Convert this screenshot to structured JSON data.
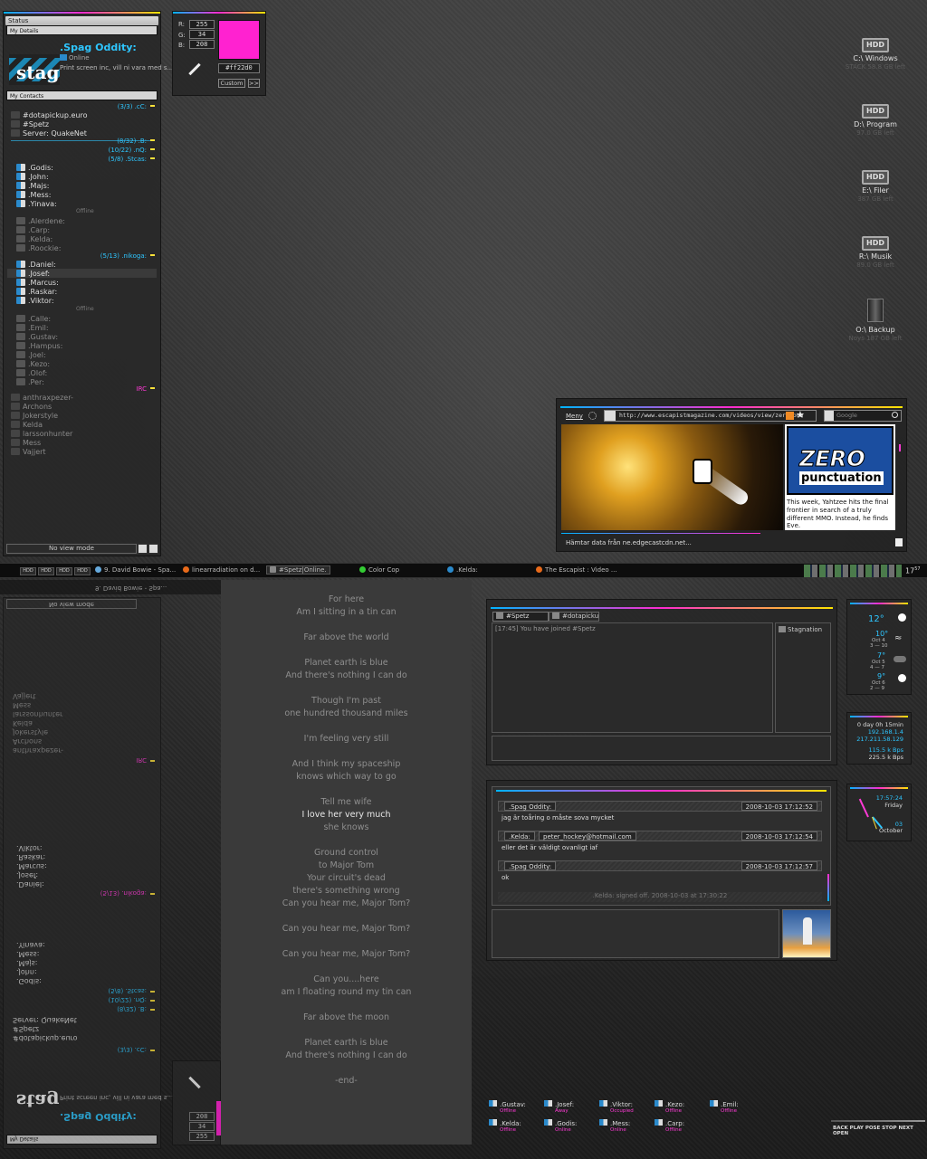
{
  "left_panel": {
    "status_label": "Status",
    "my_details_label": "My Details",
    "user_name": ".Spag Oddity:",
    "user_status": "Online",
    "user_message": "Print screen inc, vill ni vara med s...",
    "logo_text": "stag",
    "my_contacts_label": "My Contacts",
    "irc_group": "(3/3)  .cC:",
    "irc_items": [
      "#dotapickup.euro",
      "#Spetz",
      "Server: QuakeNet"
    ],
    "group_b": "(8/32)  .B:",
    "group_nq": "(10/22)  .nQ:",
    "group_stcas": "(5/8)  .Stcas:",
    "stcas_online": [
      ".Godis:",
      ".John:",
      ".Majs:",
      ".Mess:",
      ".Yinava:"
    ],
    "offline_label": "Offline",
    "stcas_offline": [
      ".Alerdene:",
      ".Carp:",
      ".Kelda:",
      ".Roockie:"
    ],
    "group_nikoga": "(5/13)  .nikoga:",
    "nikoga_online": [
      ".Daniel:",
      ".Josef:",
      ".Marcus:",
      ".Raskar:",
      ".Viktor:"
    ],
    "nikoga_offline": [
      ".Calle:",
      ".Emil:",
      ".Gustav:",
      ".Hampus:",
      ".Joel:",
      ".Kezo:",
      ".Olof:",
      ".Per:"
    ],
    "irc_label": "IRC",
    "irc_users": [
      "anthraxpezer-",
      "Archons",
      "Jokerstyle",
      "Kelda",
      "larssonhunter",
      "Mess",
      "Vajjert"
    ],
    "view_mode": "No view mode"
  },
  "color_picker": {
    "r_label": "R:",
    "g_label": "G:",
    "b_label": "B:",
    "r": "255",
    "g": "34",
    "b": "208",
    "hex": "#ff22d0",
    "swatch": "#ff22d0",
    "custom_label": "Custom",
    "more_label": ">>"
  },
  "drives": [
    {
      "label": "C:\\ Windows",
      "sub": "STACK 58.8 GB left"
    },
    {
      "label": "D:\\ Program",
      "sub": "97.0 GB left"
    },
    {
      "label": "E:\\ Filer",
      "sub": "387 GB left"
    },
    {
      "label": "R:\\ Musik",
      "sub": "89.0 GB left"
    },
    {
      "label": "O:\\ Backup",
      "sub": "Noys 187 GB left"
    }
  ],
  "drive_icon_text": "HDD",
  "browser": {
    "menu_label": "Meny",
    "url": "http://www.escapistmagazine.com/videos/view/zero-pun",
    "search_placeholder": "Google",
    "logo_line1": "ZERO",
    "logo_line2": "punctuation",
    "article_text": "This week, Yahtzee hits the final frontier in search of a truly different MMO. Instead, he finds Eve.",
    "status": "Hämtar data från ne.edgecastcdn.net..."
  },
  "taskbar": {
    "items": [
      "9. David Bowie - Spa...",
      "linearradiation on d...",
      "#Spetz|Online.",
      "Color Cop",
      ".Kelda:",
      "The Escapist : Video ..."
    ],
    "clock": "17",
    "clock_sup": "57"
  },
  "lyrics": [
    "For here",
    "Am I sitting in a tin can",
    "",
    "Far above the world",
    "",
    "Planet earth is blue",
    "And there's nothing I can do",
    "",
    "Though I'm past",
    "one hundred thousand miles",
    "",
    "I'm feeling very still",
    "",
    "And I think my spaceship",
    "knows which way to go",
    "",
    "Tell me wife",
    "I love her very much",
    "she knows",
    "",
    "Ground control",
    "to Major Tom",
    "Your circuit's dead",
    "there's something wrong",
    "Can you hear me, Major Tom?",
    "",
    "Can you hear me, Major Tom?",
    "",
    "Can you hear me, Major Tom?",
    "",
    "Can you....here",
    "am I floating round my tin can",
    "",
    "Far above the moon",
    "",
    "Planet earth is blue",
    "And there's nothing I can do",
    "",
    "-end-"
  ],
  "lyrics_highlight_index": 17,
  "media_controls": "BACK PLAY POSE STOP NEXT OPEN",
  "irc_window": {
    "tabs": [
      "#Spetz",
      "#dotapicku..."
    ],
    "join_line": "[17:45]  You have joined #Spetz",
    "nick": "Stagnation"
  },
  "chat": {
    "messages": [
      {
        "from": ".Spag Oddity:",
        "time": "2008-10-03 17:12:52",
        "text": "jag är toåring o måste sova mycket"
      },
      {
        "from": ".Kelda:",
        "email": "peter_hockey@hotmail.com",
        "time": "2008-10-03 17:12:54",
        "text": "eller det är väldigt ovanligt iaf"
      },
      {
        "from": ".Spag Oddity:",
        "time": "2008-10-03 17:12:57",
        "text": "ok"
      }
    ],
    "signoff": ".Kelda: signed off. 2008-10-03 at 17:30:22"
  },
  "weather": {
    "now": "12°",
    "days": [
      {
        "temp": "10°",
        "date": "Oct 4",
        "range": "3 — 10"
      },
      {
        "temp": "7°",
        "date": "Oct 5",
        "range": "4 — 7"
      },
      {
        "temp": "9°",
        "date": "Oct 6",
        "range": "2 — 9"
      }
    ]
  },
  "net": {
    "uptime": "0 day 0h 15min",
    "ip1": "192.168.1.4",
    "ip2": "217.211.58.129",
    "up": "115.5 k Bps",
    "down": "225.5 k Bps"
  },
  "clock_widget": {
    "time": "17:57:24",
    "day": "Friday",
    "date": "03",
    "month": "October"
  },
  "bottom_contacts": [
    {
      "name": ".Gustav:",
      "status": "Offline"
    },
    {
      "name": ".Josef:",
      "status": "Away"
    },
    {
      "name": ".Viktor:",
      "status": "Occupied"
    },
    {
      "name": ".Kezo:",
      "status": "Offline"
    },
    {
      "name": ".Emil:",
      "status": "Offline"
    },
    {
      "name": ".Kelda:",
      "status": "Offline"
    },
    {
      "name": ".Godis:",
      "status": "Online"
    },
    {
      "name": ".Mess:",
      "status": "Online"
    },
    {
      "name": ".Carp:",
      "status": "Offline"
    }
  ]
}
